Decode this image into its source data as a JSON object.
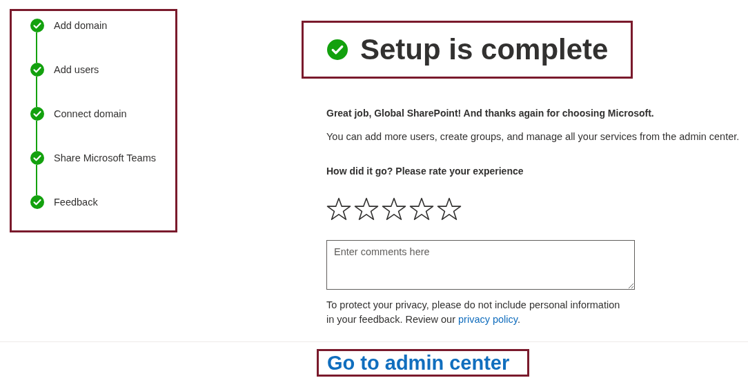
{
  "steps": [
    {
      "label": "Add domain",
      "done": true
    },
    {
      "label": "Add users",
      "done": true
    },
    {
      "label": "Connect domain",
      "done": true
    },
    {
      "label": "Share Microsoft Teams",
      "done": true
    },
    {
      "label": "Feedback",
      "done": true
    }
  ],
  "heading": {
    "title": "Setup is complete",
    "done": true
  },
  "message": "Great job, Global SharePoint! And thanks again for choosing Microsoft.",
  "details": "You can add more users, create groups, and manage all your services from the admin center.",
  "rating": {
    "prompt": "How did it go? Please rate your experience",
    "stars": 0
  },
  "comments": {
    "placeholder": "Enter comments here"
  },
  "privacy": {
    "text": "To protect your privacy, please do not include personal information in your feedback. Review our ",
    "link": "privacy policy",
    "after": "."
  },
  "footer": {
    "link": "Go to admin center"
  }
}
